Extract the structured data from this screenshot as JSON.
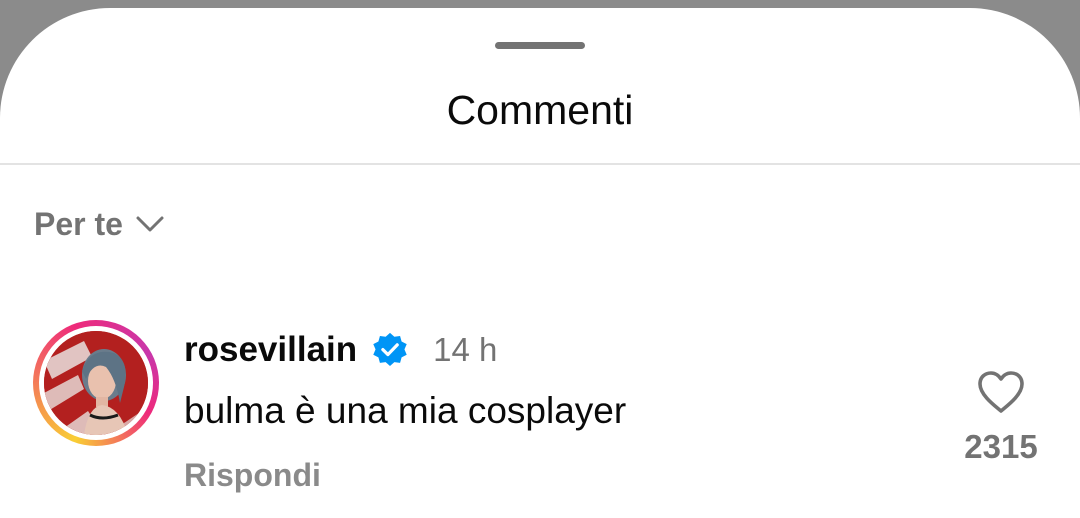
{
  "sheet": {
    "title": "Commenti"
  },
  "sort": {
    "label": "Per te",
    "icon": "chevron-down-icon"
  },
  "comment": {
    "username": "rosevillain",
    "verified": true,
    "time": "14 h",
    "text": "bulma è una mia cosplayer",
    "reply_label": "Rispondi",
    "like_count": "2315",
    "like_icon": "heart-outline-icon"
  },
  "colors": {
    "text_primary": "#0a0a0a",
    "text_secondary": "#737373",
    "verified_blue": "#0095f6",
    "divider": "#e3e3e3",
    "backdrop": "#8b8b8b"
  }
}
